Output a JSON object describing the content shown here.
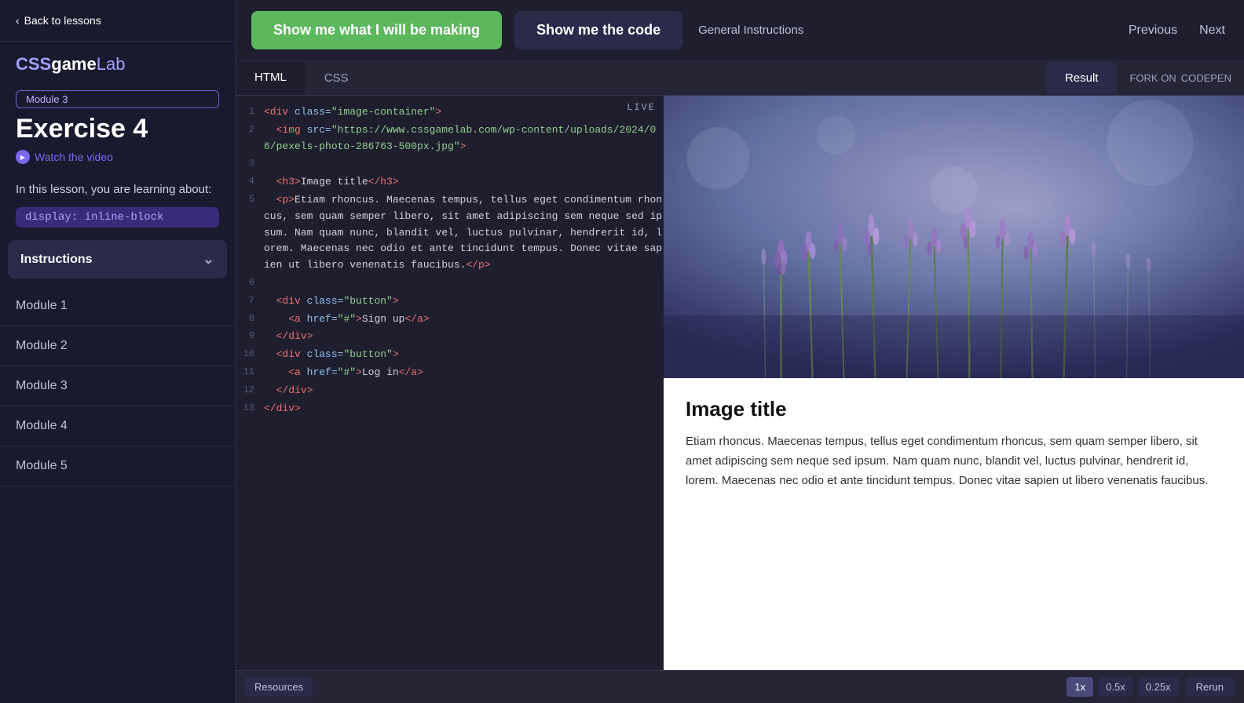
{
  "sidebar": {
    "back_label": "Back to lessons",
    "logo": {
      "css": "CSS",
      "game": "game",
      "lab": "Lab"
    },
    "module_badge": "Module 3",
    "exercise_title": "Exercise 4",
    "watch_video_label": "Watch the video",
    "learning_intro": "In this lesson, you are learning about:",
    "topic": "display: inline-block",
    "instructions_label": "Instructions",
    "modules": [
      {
        "label": "Module 1"
      },
      {
        "label": "Module 2"
      },
      {
        "label": "Module 3"
      },
      {
        "label": "Module 4"
      },
      {
        "label": "Module 5"
      }
    ]
  },
  "topnav": {
    "btn_preview_label": "Show me what I will be making",
    "btn_code_label": "Show me the code",
    "btn_instructions_label": "General Instructions",
    "btn_previous_label": "Previous",
    "btn_next_label": "Next"
  },
  "code_tabs": {
    "html_label": "HTML",
    "css_label": "CSS",
    "result_label": "Result",
    "live_label": "LIVE",
    "fork_label": "FORK ON",
    "codepen_label": "CODEPEN"
  },
  "code_lines": [
    {
      "num": 1,
      "code": "<div class=\"image-container\">"
    },
    {
      "num": 2,
      "code": "  <img src=\"https://www.cssgamelab.com/wp-content/uploads/2024/06/pexels-photo-286763-500px.jpg\">"
    },
    {
      "num": 3,
      "code": ""
    },
    {
      "num": 4,
      "code": "  <h3>Image title</h3>"
    },
    {
      "num": 5,
      "code": "  <p>Etiam rhoncus. Maecenas tempus, tellus eget condimentum rhoncus, sem quam semper libero, sit amet adipiscing sem neque sed ipsum. Nam quam nunc, blandit vel, luctus pulvinar, hendrerit id, lorem. Maecenas nec odio et ante tincidunt tempus. Donec vitae sapien ut libero venenatis faucibus.</p>"
    },
    {
      "num": 6,
      "code": ""
    },
    {
      "num": 7,
      "code": "  <div class=\"button\">"
    },
    {
      "num": 8,
      "code": "    <a href=\"#\">Sign up</a>"
    },
    {
      "num": 9,
      "code": "  </div>"
    },
    {
      "num": 10,
      "code": "  <div class=\"button\">"
    },
    {
      "num": 11,
      "code": "    <a href=\"#\">Log in</a>"
    },
    {
      "num": 12,
      "code": "  </div>"
    },
    {
      "num": 13,
      "code": "</div>"
    }
  ],
  "preview": {
    "image_alt": "Lavender flowers photo",
    "title": "Image title",
    "body_text": "Etiam rhoncus. Maecenas tempus, tellus eget condimentum rhoncus, sem quam semper libero, sit amet adipiscing sem neque sed ipsum. Nam quam nunc, blandit vel, luctus pulvinar, hendrerit id, lorem. Maecenas nec odio et ante tincidunt tempus. Donec vitae sapien ut libero venenatis faucibus."
  },
  "bottombar": {
    "resources_label": "Resources",
    "zoom_1x": "1x",
    "zoom_05x": "0.5x",
    "zoom_025x": "0.25x",
    "rerun_label": "Rerun"
  }
}
